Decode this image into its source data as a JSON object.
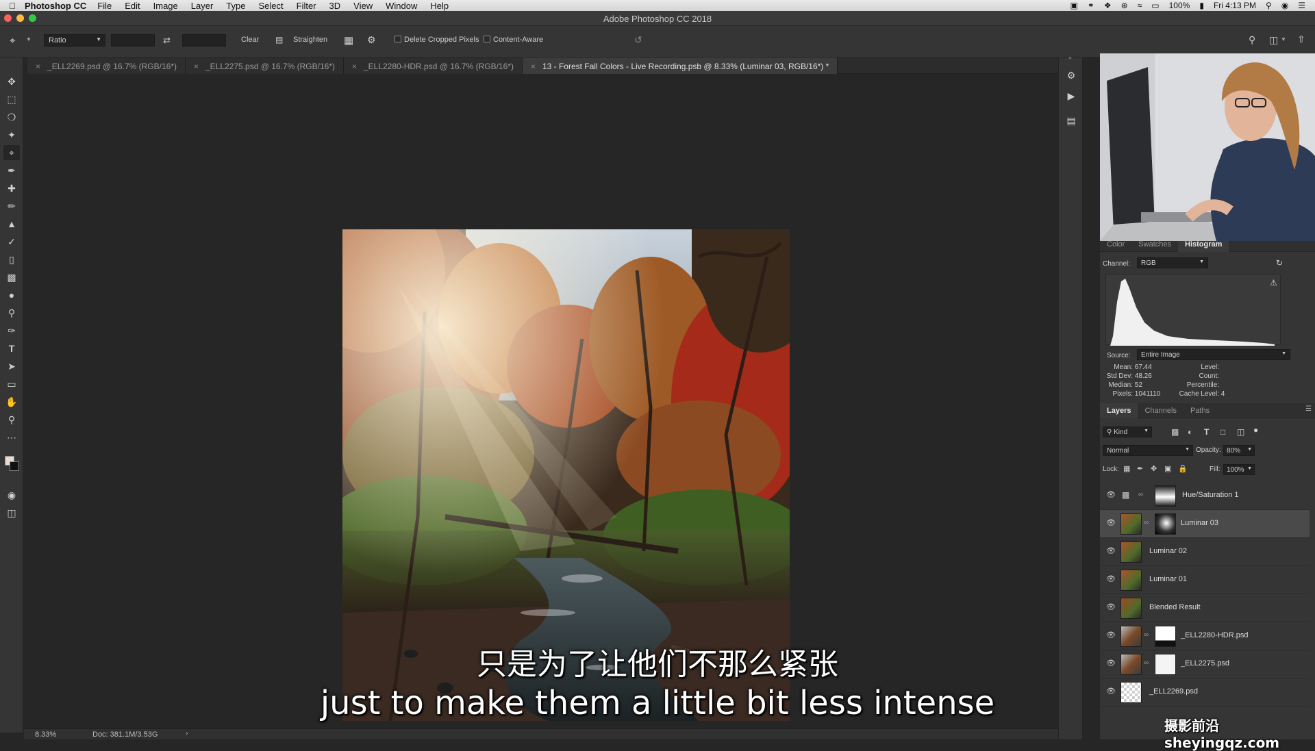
{
  "menubar": {
    "app_name": "Photoshop CC",
    "items": [
      "File",
      "Edit",
      "Image",
      "Layer",
      "Type",
      "Select",
      "Filter",
      "3D",
      "View",
      "Window",
      "Help"
    ],
    "battery": "100%",
    "clock": "Fri 4:13 PM"
  },
  "window": {
    "title": "Adobe Photoshop CC 2018"
  },
  "options": {
    "ratio_label": "Ratio",
    "clear_label": "Clear",
    "straighten_label": "Straighten",
    "delete_cropped_label": "Delete Cropped Pixels",
    "content_aware_label": "Content-Aware"
  },
  "tabs": [
    {
      "label": "_ELL2269.psd @ 16.7% (RGB/16*)",
      "active": false
    },
    {
      "label": "_ELL2275.psd @ 16.7% (RGB/16*)",
      "active": false
    },
    {
      "label": "_ELL2280-HDR.psd @ 16.7% (RGB/16*)",
      "active": false
    },
    {
      "label": "13 - Forest Fall Colors - Live Recording.psb @ 8.33% (Luminar 03, RGB/16*) *",
      "active": true
    }
  ],
  "status": {
    "zoom": "8.33%",
    "doc": "Doc: 381.1M/3.53G"
  },
  "histogram_panel": {
    "tabs": [
      "Color",
      "Swatches",
      "Histogram"
    ],
    "active_tab": "Histogram",
    "channel_label": "Channel:",
    "channel_value": "RGB",
    "source_label": "Source:",
    "source_value": "Entire Image",
    "stats_left": [
      {
        "label": "Mean:",
        "value": "67.44"
      },
      {
        "label": "Std Dev:",
        "value": "48.26"
      },
      {
        "label": "Median:",
        "value": "52"
      },
      {
        "label": "Pixels:",
        "value": "1041110"
      }
    ],
    "stats_right": [
      {
        "label": "Level:",
        "value": ""
      },
      {
        "label": "Count:",
        "value": ""
      },
      {
        "label": "Percentile:",
        "value": ""
      },
      {
        "label": "Cache Level:",
        "value": "4"
      }
    ]
  },
  "layers_panel": {
    "tabs": [
      "Layers",
      "Channels",
      "Paths"
    ],
    "active_tab": "Layers",
    "kind_label": "Kind",
    "blend_mode": "Normal",
    "opacity_label": "Opacity:",
    "opacity_value": "80%",
    "lock_label": "Lock:",
    "fill_label": "Fill:",
    "fill_value": "100%",
    "layers": [
      {
        "name": "Hue/Saturation 1",
        "type": "adjustment",
        "selected": false
      },
      {
        "name": "Luminar 03",
        "type": "masked",
        "selected": true
      },
      {
        "name": "Luminar 02",
        "type": "pixel",
        "selected": false
      },
      {
        "name": "Luminar 01",
        "type": "pixel",
        "selected": false
      },
      {
        "name": "Blended Result",
        "type": "pixel",
        "selected": false
      },
      {
        "name": "_ELL2280-HDR.psd",
        "type": "masked-white",
        "selected": false
      },
      {
        "name": "_ELL2275.psd",
        "type": "masked-white",
        "selected": false
      },
      {
        "name": "_ELL2269.psd",
        "type": "transparent",
        "selected": false
      }
    ]
  },
  "subtitles": {
    "chinese": "只是为了让他们不那么紧张",
    "english": "just to make them a little bit less intense"
  },
  "watermark": "摄影前沿 sheyingqz.com"
}
